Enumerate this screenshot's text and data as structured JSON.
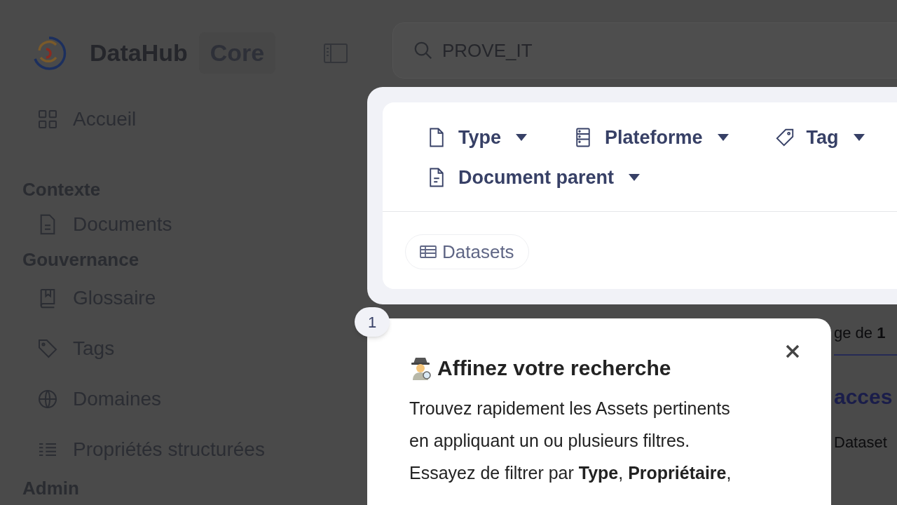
{
  "header": {
    "brand": "DataHub",
    "edition": "Core"
  },
  "search": {
    "value": "PROVE_IT"
  },
  "sidebar": {
    "groups": [
      {
        "items": [
          {
            "label": "Accueil"
          }
        ]
      },
      {
        "title": "Contexte",
        "items": [
          {
            "label": "Documents"
          }
        ]
      },
      {
        "title": "Gouvernance",
        "items": [
          {
            "label": "Glossaire"
          },
          {
            "label": "Tags"
          },
          {
            "label": "Domaines"
          },
          {
            "label": "Propriétés structurées"
          }
        ]
      },
      {
        "title": "Admin"
      }
    ]
  },
  "filters": [
    {
      "label": "Type"
    },
    {
      "label": "Plateforme"
    },
    {
      "label": "Tag"
    },
    {
      "label": "Document parent"
    }
  ],
  "chip": {
    "label": "Datasets"
  },
  "results": {
    "range_text": "ge de **1**",
    "title": "acces",
    "type": "Dataset"
  },
  "tour": {
    "step": "1",
    "title": "Affinez votre recherche",
    "body": [
      "Trouvez rapidement les Assets pertinents",
      "en appliquant un ou plusieurs filtres.",
      "Essayez de filtrer par **Type**, **Propriétaire**,"
    ]
  }
}
